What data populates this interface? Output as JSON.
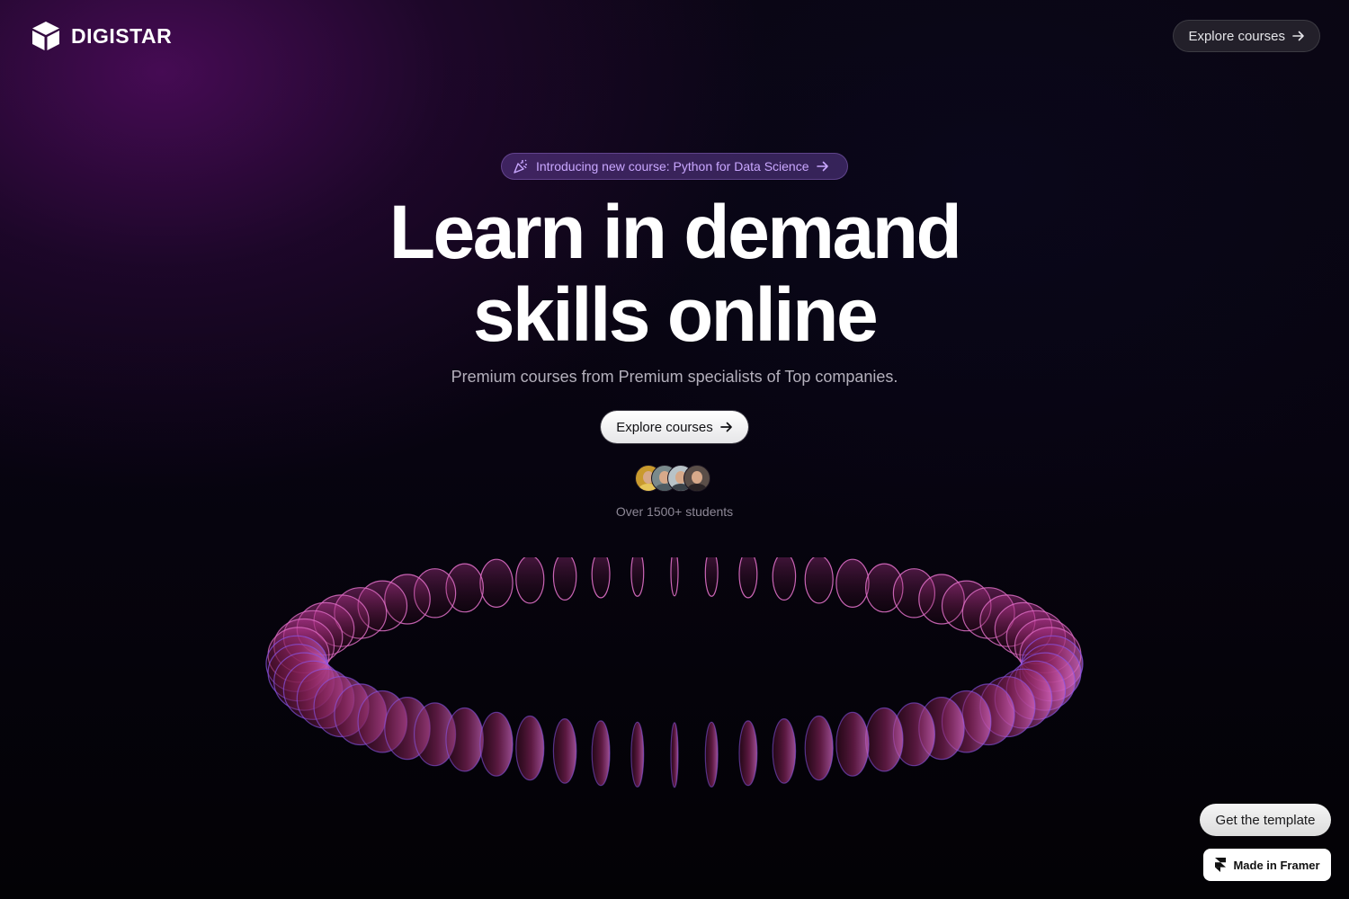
{
  "brand": {
    "name": "DIGISTAR",
    "logo_icon": "cube-icon"
  },
  "header": {
    "nav_button_label": "Explore courses",
    "nav_button_icon": "arrow-right-icon"
  },
  "hero": {
    "announcement": {
      "icon": "sparkle-party-icon",
      "text": "Introducing new course: Python for Data Science",
      "arrow_icon": "arrow-right-icon"
    },
    "headline_line1": "Learn in demand",
    "headline_line2": "skills online",
    "subtitle": "Premium courses from Premium specialists of Top companies.",
    "cta_label": "Explore courses",
    "cta_icon": "arrow-right-icon",
    "avatars": [
      {
        "name": "student-avatar-1",
        "bg": "#c99a2e",
        "shirt": "#e7c65a"
      },
      {
        "name": "student-avatar-2",
        "bg": "#7a8a8c",
        "shirt": "#4e5c63"
      },
      {
        "name": "student-avatar-3",
        "bg": "#b8c3c8",
        "shirt": "#394148"
      },
      {
        "name": "student-avatar-4",
        "bg": "#5a4e48",
        "shirt": "#2a2426"
      }
    ],
    "students_text": "Over 1500+ students"
  },
  "floating": {
    "template_button": "Get the template",
    "framer_badge": "Made in Framer",
    "framer_icon": "framer-logo-icon"
  },
  "colors": {
    "background": "#050308",
    "accent_purple": "#c9a7ff",
    "ring_glow": "#b0307a"
  }
}
